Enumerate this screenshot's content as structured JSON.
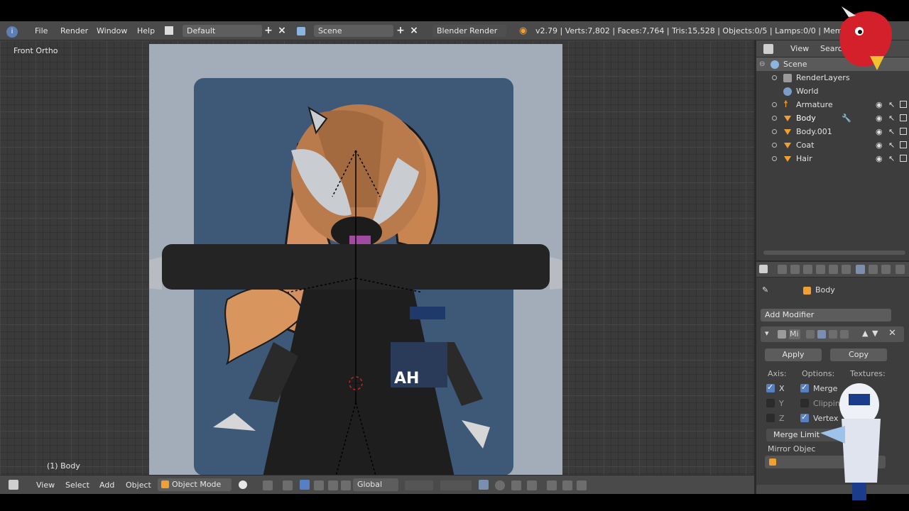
{
  "info_bar": {
    "menus": [
      "File",
      "Render",
      "Window",
      "Help"
    ],
    "layout_name": "Default",
    "scene_name": "Scene",
    "render_engine": "Blender Render",
    "stats": "v2.79 | Verts:7,802 | Faces:7,764 | Tris:15,528 | Objects:0/5 | Lamps:0/0 | Mem:31.03"
  },
  "viewport": {
    "view_label": "Front Ortho",
    "object_label": "(1) Body",
    "ref_text": "AH"
  },
  "viewport_header": {
    "menus": [
      "View",
      "Select",
      "Add",
      "Object"
    ],
    "mode": "Object Mode",
    "orientation": "Global"
  },
  "outliner": {
    "header_view": "View",
    "header_search": "Search",
    "items": [
      {
        "label": "Scene"
      },
      {
        "label": "RenderLayers"
      },
      {
        "label": "World"
      },
      {
        "label": "Armature"
      },
      {
        "label": "Body"
      },
      {
        "label": "Body.001"
      },
      {
        "label": "Coat"
      },
      {
        "label": "Hair"
      }
    ]
  },
  "properties": {
    "object_name": "Body",
    "add_modifier": "Add Modifier",
    "apply_label": "Apply",
    "copy_label": "Copy",
    "axis_label": "Axis:",
    "options_label": "Options:",
    "textures_label": "Textures:",
    "axes": [
      "X",
      "Y",
      "Z"
    ],
    "options": [
      "Merge",
      "Clippin",
      "Vertex"
    ],
    "merge_limit": "Merge Limit",
    "mirror_object": "Mirror Objec",
    "mod_short": "Mi"
  },
  "colors": {
    "panel": "#3d3d3d",
    "header": "#4a4a4a",
    "accent": "#5680c2",
    "object_icon": "#f0a030"
  }
}
